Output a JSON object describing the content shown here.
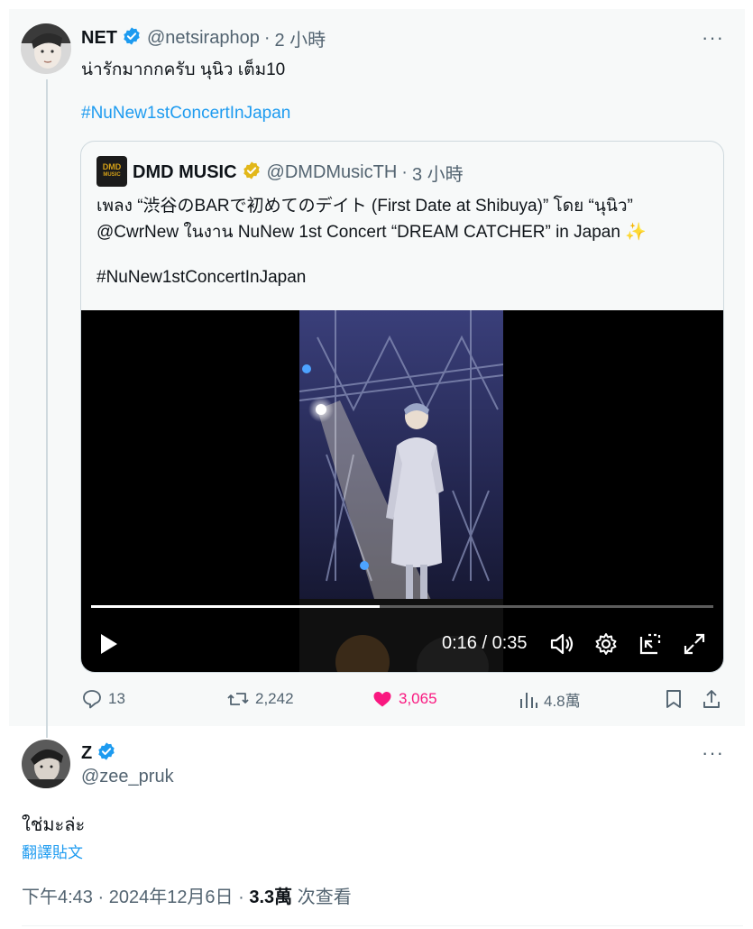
{
  "parent": {
    "name": "NET",
    "handle": "@netsiraphop",
    "sep": "·",
    "time": "2 小時",
    "more": "···",
    "text": "น่ารักมากกครับ นุนิว เต็ม10",
    "hashtag": "#NuNew1stConcertInJapan"
  },
  "quote": {
    "logo_top": "DMD",
    "logo_bottom": "MUSIC",
    "name": "DMD MUSIC",
    "handle": "@DMDMusicTH",
    "sep": "·",
    "time": "3 小時",
    "line1": "เพลง “渋谷のBARで初めてのデイト (First Date at Shibuya)” โดย “นุนิว”",
    "line2": "@CwrNew ในงาน NuNew 1st Concert “DREAM CATCHER” in Japan ✨",
    "hashtag": "#NuNew1stConcertInJapan"
  },
  "video": {
    "time": "0:16 / 0:35",
    "progress": 0.464
  },
  "actions": {
    "replies": "13",
    "reposts": "2,242",
    "likes": "3,065",
    "views": "4.8萬"
  },
  "reply": {
    "name": "Z",
    "handle": "@zee_pruk",
    "more": "···",
    "text": "ใช่มะล่ะ",
    "translate": "翻譯貼文",
    "timestamp": "下午4:43 · 2024年12月6日 · ",
    "views_count": "3.3萬",
    "views_label": " 次查看"
  },
  "colors": {
    "accent": "#1d9bf0",
    "like": "#f91880",
    "muted": "#536471",
    "gold": "#e2b719"
  }
}
